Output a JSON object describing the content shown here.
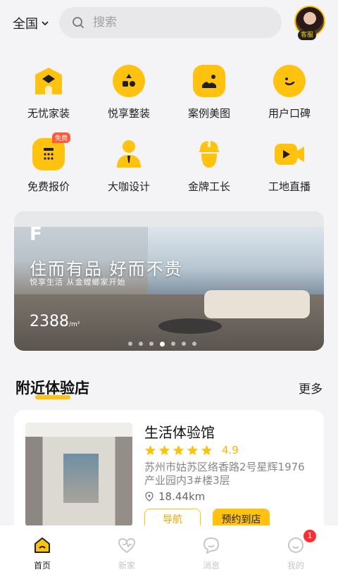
{
  "header": {
    "city": "全国",
    "search_placeholder": "搜索",
    "service_badge": "客服"
  },
  "grid": [
    {
      "label": "无忧家装",
      "icon": "house-icon"
    },
    {
      "label": "悦享整装",
      "icon": "blocks-icon"
    },
    {
      "label": "案例美图",
      "icon": "image-icon"
    },
    {
      "label": "用户口碑",
      "icon": "smile-chat-icon"
    },
    {
      "label": "免费报价",
      "icon": "calculator-icon",
      "tag": "免费"
    },
    {
      "label": "大咖设计",
      "icon": "designer-icon"
    },
    {
      "label": "金牌工长",
      "icon": "foreman-icon"
    },
    {
      "label": "工地直播",
      "icon": "video-icon"
    }
  ],
  "banner": {
    "title": "住而有品 好而不贵",
    "subtitle": "悦享生活 从金螳螂家开始",
    "price": "2388",
    "unit": "/m²",
    "slide_count": 7,
    "active_slide": 3
  },
  "section": {
    "title": "附近体验店",
    "more": "更多"
  },
  "store": {
    "name": "生活体验馆",
    "rating": "4.9",
    "stars": 5,
    "address": "苏州市姑苏区络香路2号星辉1976产业园内3#楼3层",
    "distance": "18.44km",
    "nav_label": "导航",
    "book_label": "预约到店"
  },
  "nav": {
    "items": [
      {
        "label": "首页",
        "icon": "home-icon",
        "active": true
      },
      {
        "label": "新家",
        "icon": "heart-home-icon"
      },
      {
        "label": "消息",
        "icon": "message-icon"
      },
      {
        "label": "我的",
        "icon": "profile-icon",
        "badge": "1"
      }
    ]
  },
  "colors": {
    "accent": "#ffc20e",
    "badge": "#ff2d2d"
  }
}
